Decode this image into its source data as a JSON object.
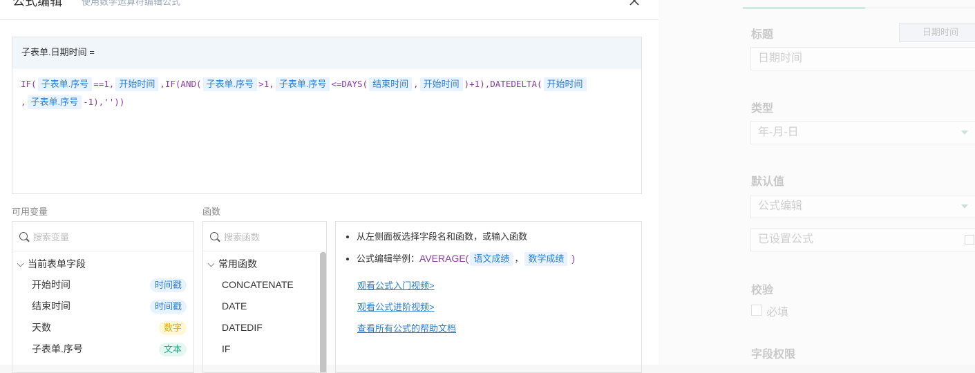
{
  "modal": {
    "title": "公式编辑",
    "subtitle": "使用数学运算符编辑公式",
    "editor_head": "子表单.日期时间 =",
    "formula": {
      "line1": [
        {
          "t": "fn",
          "v": "IF("
        },
        {
          "t": "tok",
          "v": "子表单.序号"
        },
        {
          "t": "fn",
          "v": "==1,"
        },
        {
          "t": "tok",
          "v": "开始时间"
        },
        {
          "t": "fn",
          "v": ",IF(AND("
        },
        {
          "t": "tok",
          "v": "子表单.序号"
        },
        {
          "t": "fn",
          "v": ">1,"
        },
        {
          "t": "tok",
          "v": "子表单.序号"
        },
        {
          "t": "fn",
          "v": "<=DAYS("
        },
        {
          "t": "tok",
          "v": "结束时间"
        },
        {
          "t": "fn",
          "v": ","
        },
        {
          "t": "tok",
          "v": "开始时间"
        },
        {
          "t": "fn",
          "v": ")+1),DATEDELTA("
        },
        {
          "t": "tok",
          "v": "开始时间"
        }
      ],
      "line2": [
        {
          "t": "fn",
          "v": ","
        },
        {
          "t": "tok",
          "v": "子表单.序号"
        },
        {
          "t": "fn",
          "v": "-1),''))"
        }
      ]
    },
    "vars_label": "可用变量",
    "funcs_label": "函数",
    "vars_search_placeholder": "搜索变量",
    "funcs_search_placeholder": "搜索函数",
    "vars_group": "当前表单字段",
    "vars": [
      {
        "name": "开始时间",
        "type": "时间戳",
        "color": "blue"
      },
      {
        "name": "结束时间",
        "type": "时间戳",
        "color": "blue"
      },
      {
        "name": "天数",
        "type": "数字",
        "color": "yellow"
      },
      {
        "name": "子表单.序号",
        "type": "文本",
        "color": "green"
      }
    ],
    "funcs_group": "常用函数",
    "funcs": [
      "CONCATENATE",
      "DATE",
      "DATEDIF",
      "IF"
    ],
    "help": {
      "tip1": "从左侧面板选择字段名和函数，或输入函数",
      "tip2_prefix": "公式编辑举例：",
      "tip2_fn": "AVERAGE(",
      "tip2_tok1": "语文成绩",
      "tip2_sep": "，",
      "tip2_tok2": "数学成绩",
      "tip2_end": ")",
      "link1": "观看公式入门视频>",
      "link2": "观看公式进阶视频>",
      "link3": "查看所有公式的帮助文档"
    }
  },
  "side": {
    "title_label": "标题",
    "title_tag": "日期时间",
    "title_value": "日期时间",
    "type_label": "类型",
    "type_value": "年-月-日",
    "default_label": "默认值",
    "default_value": "公式编辑",
    "formula_set": "已设置公式",
    "validate_label": "校验",
    "required_label": "必填",
    "perm_label": "字段权限"
  },
  "colors": {
    "token_bg": "#e8f3ff",
    "token_fg": "#2d7dcf",
    "function_fg": "#8a3aa0"
  }
}
